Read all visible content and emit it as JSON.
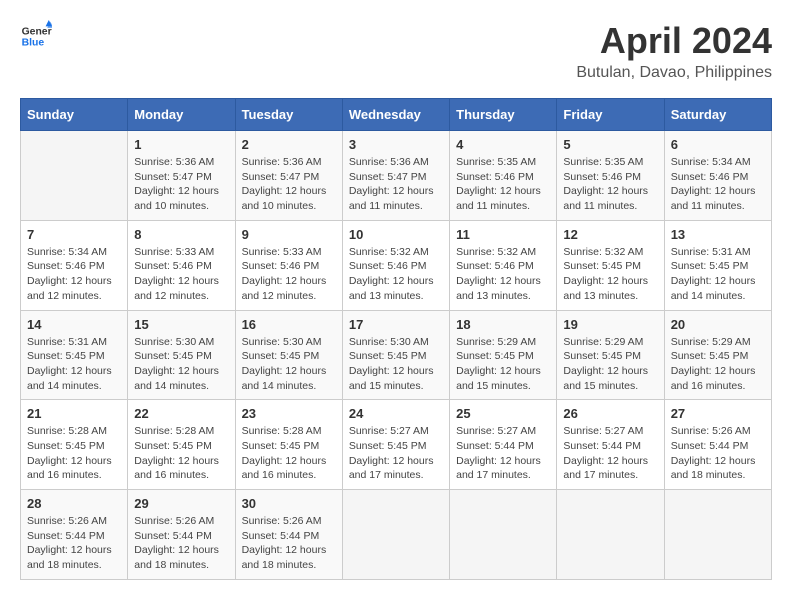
{
  "header": {
    "logo_line1": "General",
    "logo_line2": "Blue",
    "month_year": "April 2024",
    "location": "Butulan, Davao, Philippines"
  },
  "days_of_week": [
    "Sunday",
    "Monday",
    "Tuesday",
    "Wednesday",
    "Thursday",
    "Friday",
    "Saturday"
  ],
  "weeks": [
    [
      {
        "day": "",
        "sunrise": "",
        "sunset": "",
        "daylight": ""
      },
      {
        "day": "1",
        "sunrise": "Sunrise: 5:36 AM",
        "sunset": "Sunset: 5:47 PM",
        "daylight": "Daylight: 12 hours and 10 minutes."
      },
      {
        "day": "2",
        "sunrise": "Sunrise: 5:36 AM",
        "sunset": "Sunset: 5:47 PM",
        "daylight": "Daylight: 12 hours and 10 minutes."
      },
      {
        "day": "3",
        "sunrise": "Sunrise: 5:36 AM",
        "sunset": "Sunset: 5:47 PM",
        "daylight": "Daylight: 12 hours and 11 minutes."
      },
      {
        "day": "4",
        "sunrise": "Sunrise: 5:35 AM",
        "sunset": "Sunset: 5:46 PM",
        "daylight": "Daylight: 12 hours and 11 minutes."
      },
      {
        "day": "5",
        "sunrise": "Sunrise: 5:35 AM",
        "sunset": "Sunset: 5:46 PM",
        "daylight": "Daylight: 12 hours and 11 minutes."
      },
      {
        "day": "6",
        "sunrise": "Sunrise: 5:34 AM",
        "sunset": "Sunset: 5:46 PM",
        "daylight": "Daylight: 12 hours and 11 minutes."
      }
    ],
    [
      {
        "day": "7",
        "sunrise": "Sunrise: 5:34 AM",
        "sunset": "Sunset: 5:46 PM",
        "daylight": "Daylight: 12 hours and 12 minutes."
      },
      {
        "day": "8",
        "sunrise": "Sunrise: 5:33 AM",
        "sunset": "Sunset: 5:46 PM",
        "daylight": "Daylight: 12 hours and 12 minutes."
      },
      {
        "day": "9",
        "sunrise": "Sunrise: 5:33 AM",
        "sunset": "Sunset: 5:46 PM",
        "daylight": "Daylight: 12 hours and 12 minutes."
      },
      {
        "day": "10",
        "sunrise": "Sunrise: 5:32 AM",
        "sunset": "Sunset: 5:46 PM",
        "daylight": "Daylight: 12 hours and 13 minutes."
      },
      {
        "day": "11",
        "sunrise": "Sunrise: 5:32 AM",
        "sunset": "Sunset: 5:46 PM",
        "daylight": "Daylight: 12 hours and 13 minutes."
      },
      {
        "day": "12",
        "sunrise": "Sunrise: 5:32 AM",
        "sunset": "Sunset: 5:45 PM",
        "daylight": "Daylight: 12 hours and 13 minutes."
      },
      {
        "day": "13",
        "sunrise": "Sunrise: 5:31 AM",
        "sunset": "Sunset: 5:45 PM",
        "daylight": "Daylight: 12 hours and 14 minutes."
      }
    ],
    [
      {
        "day": "14",
        "sunrise": "Sunrise: 5:31 AM",
        "sunset": "Sunset: 5:45 PM",
        "daylight": "Daylight: 12 hours and 14 minutes."
      },
      {
        "day": "15",
        "sunrise": "Sunrise: 5:30 AM",
        "sunset": "Sunset: 5:45 PM",
        "daylight": "Daylight: 12 hours and 14 minutes."
      },
      {
        "day": "16",
        "sunrise": "Sunrise: 5:30 AM",
        "sunset": "Sunset: 5:45 PM",
        "daylight": "Daylight: 12 hours and 14 minutes."
      },
      {
        "day": "17",
        "sunrise": "Sunrise: 5:30 AM",
        "sunset": "Sunset: 5:45 PM",
        "daylight": "Daylight: 12 hours and 15 minutes."
      },
      {
        "day": "18",
        "sunrise": "Sunrise: 5:29 AM",
        "sunset": "Sunset: 5:45 PM",
        "daylight": "Daylight: 12 hours and 15 minutes."
      },
      {
        "day": "19",
        "sunrise": "Sunrise: 5:29 AM",
        "sunset": "Sunset: 5:45 PM",
        "daylight": "Daylight: 12 hours and 15 minutes."
      },
      {
        "day": "20",
        "sunrise": "Sunrise: 5:29 AM",
        "sunset": "Sunset: 5:45 PM",
        "daylight": "Daylight: 12 hours and 16 minutes."
      }
    ],
    [
      {
        "day": "21",
        "sunrise": "Sunrise: 5:28 AM",
        "sunset": "Sunset: 5:45 PM",
        "daylight": "Daylight: 12 hours and 16 minutes."
      },
      {
        "day": "22",
        "sunrise": "Sunrise: 5:28 AM",
        "sunset": "Sunset: 5:45 PM",
        "daylight": "Daylight: 12 hours and 16 minutes."
      },
      {
        "day": "23",
        "sunrise": "Sunrise: 5:28 AM",
        "sunset": "Sunset: 5:45 PM",
        "daylight": "Daylight: 12 hours and 16 minutes."
      },
      {
        "day": "24",
        "sunrise": "Sunrise: 5:27 AM",
        "sunset": "Sunset: 5:45 PM",
        "daylight": "Daylight: 12 hours and 17 minutes."
      },
      {
        "day": "25",
        "sunrise": "Sunrise: 5:27 AM",
        "sunset": "Sunset: 5:44 PM",
        "daylight": "Daylight: 12 hours and 17 minutes."
      },
      {
        "day": "26",
        "sunrise": "Sunrise: 5:27 AM",
        "sunset": "Sunset: 5:44 PM",
        "daylight": "Daylight: 12 hours and 17 minutes."
      },
      {
        "day": "27",
        "sunrise": "Sunrise: 5:26 AM",
        "sunset": "Sunset: 5:44 PM",
        "daylight": "Daylight: 12 hours and 18 minutes."
      }
    ],
    [
      {
        "day": "28",
        "sunrise": "Sunrise: 5:26 AM",
        "sunset": "Sunset: 5:44 PM",
        "daylight": "Daylight: 12 hours and 18 minutes."
      },
      {
        "day": "29",
        "sunrise": "Sunrise: 5:26 AM",
        "sunset": "Sunset: 5:44 PM",
        "daylight": "Daylight: 12 hours and 18 minutes."
      },
      {
        "day": "30",
        "sunrise": "Sunrise: 5:26 AM",
        "sunset": "Sunset: 5:44 PM",
        "daylight": "Daylight: 12 hours and 18 minutes."
      },
      {
        "day": "",
        "sunrise": "",
        "sunset": "",
        "daylight": ""
      },
      {
        "day": "",
        "sunrise": "",
        "sunset": "",
        "daylight": ""
      },
      {
        "day": "",
        "sunrise": "",
        "sunset": "",
        "daylight": ""
      },
      {
        "day": "",
        "sunrise": "",
        "sunset": "",
        "daylight": ""
      }
    ]
  ]
}
